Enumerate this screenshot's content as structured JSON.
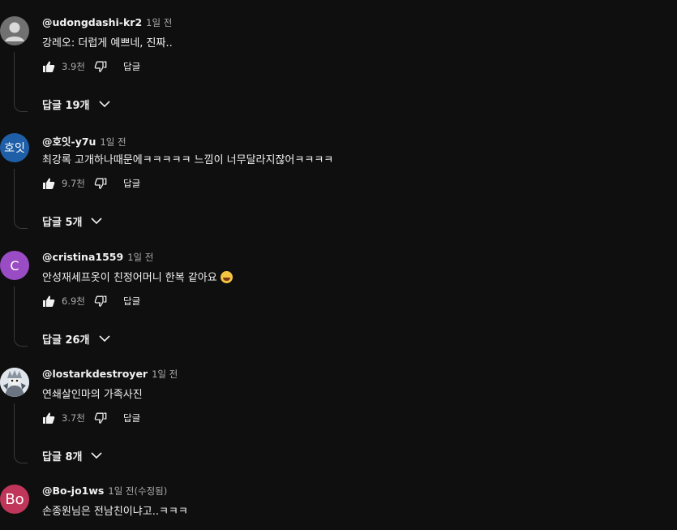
{
  "comments": [
    {
      "author": "@udongdashi-kr2",
      "time": "1일 전",
      "text": "강레오: 더럽게 예쁘네, 진짜..",
      "likes": "3.9천",
      "reply_label": "답글",
      "replies_label": "답글 19개",
      "avatar": {
        "type": "default",
        "color": "#717171"
      }
    },
    {
      "author": "@호잇-y7u",
      "time": "1일 전",
      "text": "최강록 고개하나때문에ㅋㅋㅋㅋㅋ 느낌이 너무달라지잖어ㅋㅋㅋㅋ",
      "likes": "9.7천",
      "reply_label": "답글",
      "replies_label": "답글 5개",
      "avatar": {
        "type": "text",
        "text": "호잇",
        "color": "#1f5fa8"
      }
    },
    {
      "author": "@cristina1559",
      "time": "1일 전",
      "text": "안성재세프옷이 친정어머니 한복 같아요",
      "emoji": "grinning-sweat-emoji",
      "likes": "6.9천",
      "reply_label": "답글",
      "replies_label": "답글 26개",
      "avatar": {
        "type": "text",
        "text": "C",
        "color": "#9a4cc4"
      }
    },
    {
      "author": "@lostarkdestroyer",
      "time": "1일 전",
      "text": "연쇄살인마의 가족사진",
      "likes": "3.7천",
      "reply_label": "답글",
      "replies_label": "답글 8개",
      "avatar": {
        "type": "image",
        "color": "#cfd6dc"
      }
    },
    {
      "author": "@Bo-jo1ws",
      "time": "1일 전(수정됨)",
      "text": "손종원님은 전남친이냐고..ㅋㅋㅋ",
      "avatar": {
        "type": "text",
        "text": "Bo",
        "color": "#c0365a"
      }
    }
  ],
  "icons": {
    "like": "thumbs-up-icon",
    "dislike": "thumbs-down-icon",
    "expand": "chevron-down-icon"
  }
}
